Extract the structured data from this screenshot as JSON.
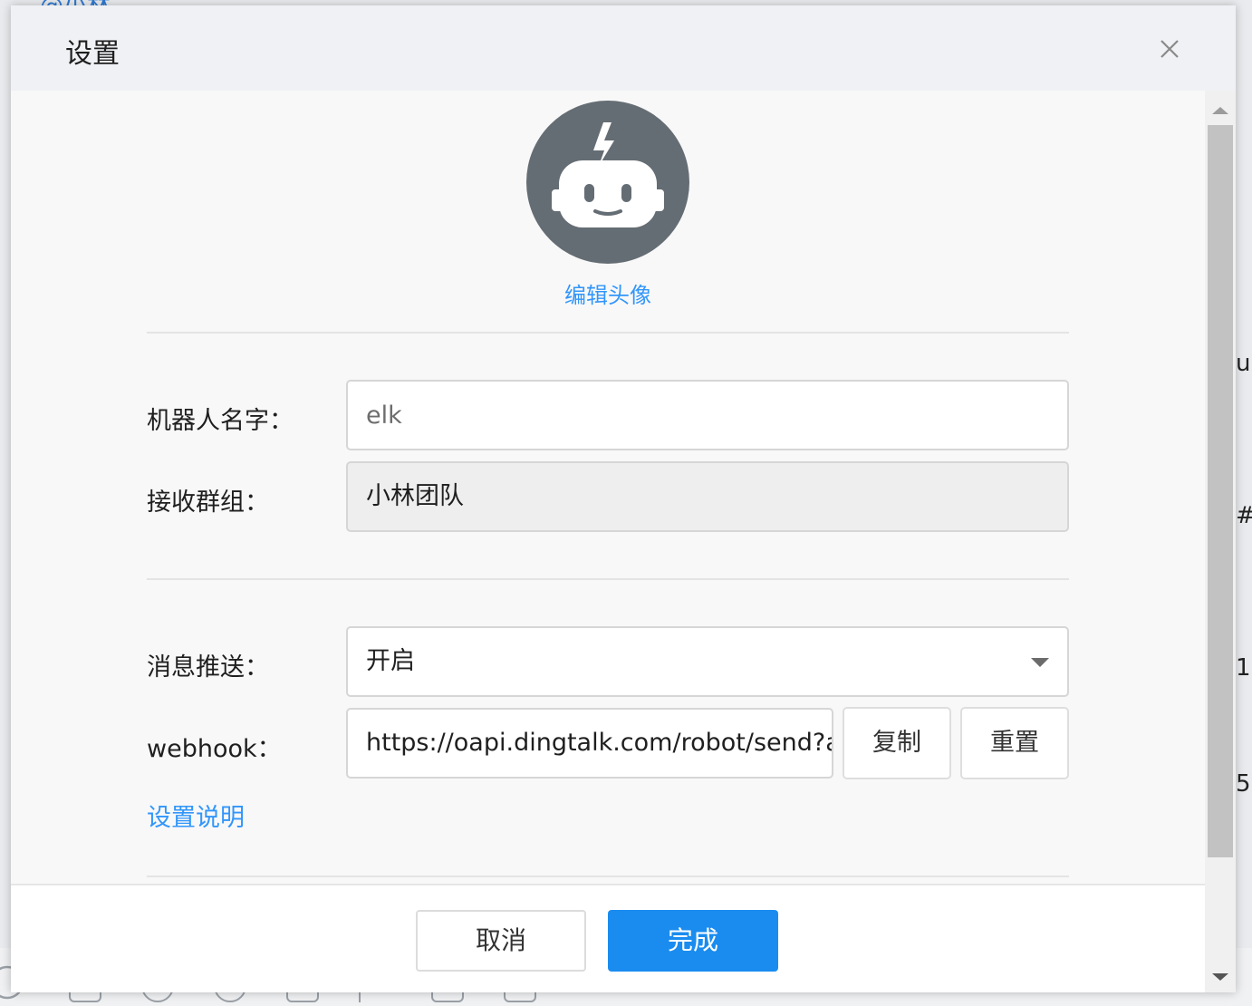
{
  "background": {
    "top_tab_text": "@小林",
    "right_fragments": [
      "ul",
      "#",
      "1",
      "5"
    ]
  },
  "dialog": {
    "title": "设置",
    "close_icon": "close-icon",
    "avatar": {
      "icon": "robot-icon",
      "color": "#656d74",
      "edit_label": "编辑头像"
    },
    "form": {
      "robot_name_label": "机器人名字：",
      "robot_name_value": "elk",
      "group_label": "接收群组：",
      "group_value": "小林团队",
      "push_label": "消息推送：",
      "push_value": "开启",
      "webhook_label": "webhook：",
      "webhook_value": "https://oapi.dingtalk.com/robot/send?access_token=",
      "copy_label": "复制",
      "reset_label": "重置",
      "help_link": "设置说明"
    },
    "footer": {
      "cancel_label": "取消",
      "done_label": "完成"
    }
  },
  "colors": {
    "accent": "#1a8cf0",
    "link": "#3296fa",
    "header_bg": "#eff1f4"
  }
}
